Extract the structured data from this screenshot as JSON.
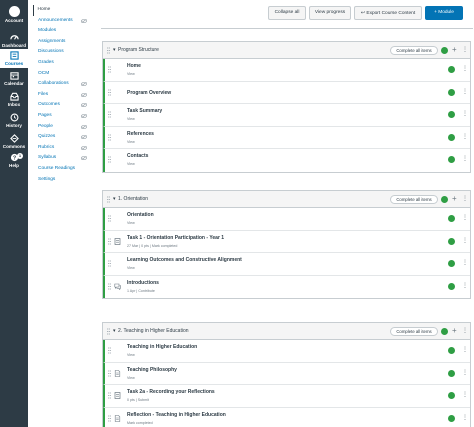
{
  "global_nav": [
    {
      "label": "Account",
      "icon": "account-icon"
    },
    {
      "label": "Dashboard",
      "icon": "dashboard-icon"
    },
    {
      "label": "Courses",
      "icon": "courses-icon"
    },
    {
      "label": "Calendar",
      "icon": "calendar-icon"
    },
    {
      "label": "Inbox",
      "icon": "inbox-icon"
    },
    {
      "label": "History",
      "icon": "history-icon"
    },
    {
      "label": "Commons",
      "icon": "commons-icon"
    },
    {
      "label": "Help",
      "icon": "help-icon",
      "badge": "1"
    }
  ],
  "course_nav": [
    {
      "label": "Home"
    },
    {
      "label": "Announcements"
    },
    {
      "label": "Modules"
    },
    {
      "label": "Assignments"
    },
    {
      "label": "Discussions"
    },
    {
      "label": "Grades"
    },
    {
      "label": "OCM"
    },
    {
      "label": "Collaborations"
    },
    {
      "label": "Files"
    },
    {
      "label": "Outcomes"
    },
    {
      "label": "Pages"
    },
    {
      "label": "People"
    },
    {
      "label": "Quizzes"
    },
    {
      "label": "Rubrics"
    },
    {
      "label": "Syllabus"
    },
    {
      "label": "Course Readings"
    },
    {
      "label": "Settings"
    }
  ],
  "toolbar": {
    "collapse_all": "Collapse all",
    "view_progress": "View progress",
    "export": "Export Course Content",
    "add_module": "+ Module"
  },
  "modules": [
    {
      "title": "Program Structure",
      "req_label": "Complete all items",
      "items": [
        {
          "title": "Home",
          "sub": "View"
        },
        {
          "title": "Program Overview",
          "sub": ""
        },
        {
          "title": "Task Summary",
          "sub": "View"
        },
        {
          "title": "References",
          "sub": "View"
        },
        {
          "title": "Contacts",
          "sub": "View"
        }
      ]
    },
    {
      "title": "1. Orientation",
      "req_label": "Complete all items",
      "items": [
        {
          "title": "Orientation",
          "sub": "View"
        },
        {
          "title": "Task 1 - Orientation Participation - Year 1",
          "sub": "27 Mar  |  0 pts  |  Mark completed"
        },
        {
          "title": "Learning Outcomes and Constructive Alignment",
          "sub": "View"
        },
        {
          "title": "Introductions",
          "sub": "1 Apr  |  Contribute"
        }
      ]
    },
    {
      "title": "2. Teaching in Higher Education",
      "req_label": "Complete all items",
      "items": [
        {
          "title": "Teaching in Higher Education",
          "sub": "View"
        },
        {
          "title": "Teaching Philosophy",
          "sub": "View"
        },
        {
          "title": "Task 2a - Recording your Reflections",
          "sub": "0 pts  |  Submit"
        },
        {
          "title": "Reflection - Teaching in Higher Education",
          "sub": "Mark completed"
        }
      ]
    }
  ]
}
